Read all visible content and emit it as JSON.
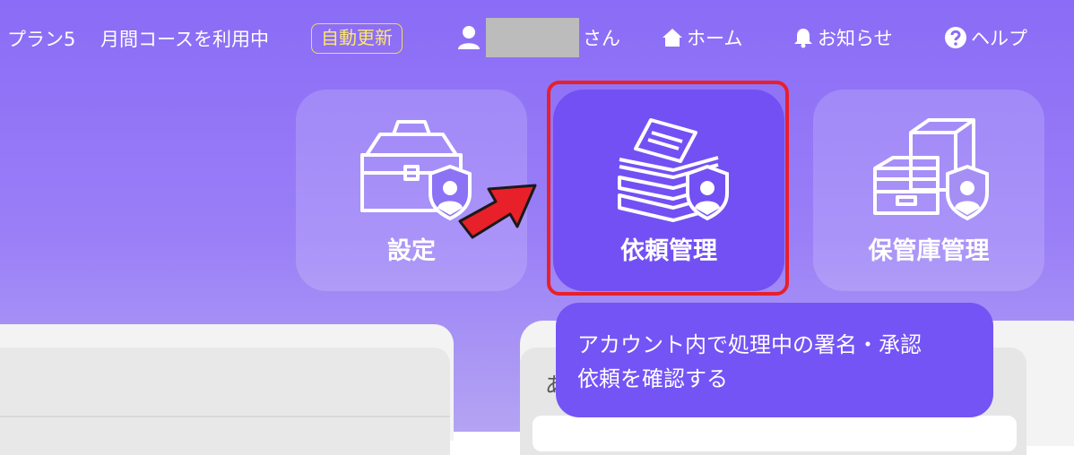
{
  "header": {
    "plan": "プラン5",
    "course": "月間コースを利用中",
    "auto_renew_badge": "自動更新",
    "user_suffix": "さん",
    "nav": {
      "home": "ホーム",
      "news": "お知らせ",
      "help": "ヘルプ"
    }
  },
  "tiles": [
    {
      "label": "設定",
      "icon": "toolbox-shield-icon"
    },
    {
      "label": "依頼管理",
      "icon": "document-stack-shield-icon"
    },
    {
      "label": "保管庫管理",
      "icon": "storage-boxes-shield-icon"
    }
  ],
  "tooltip": {
    "line1": "アカウント内で処理中の署名・承認",
    "line2": "依頼を確認する"
  },
  "panel_right": {
    "glyph": "あ"
  },
  "colors": {
    "accent": "#7350f4",
    "highlight_border": "#e8202a",
    "badge": "#f4dc57",
    "arrow": "#e8202a"
  }
}
